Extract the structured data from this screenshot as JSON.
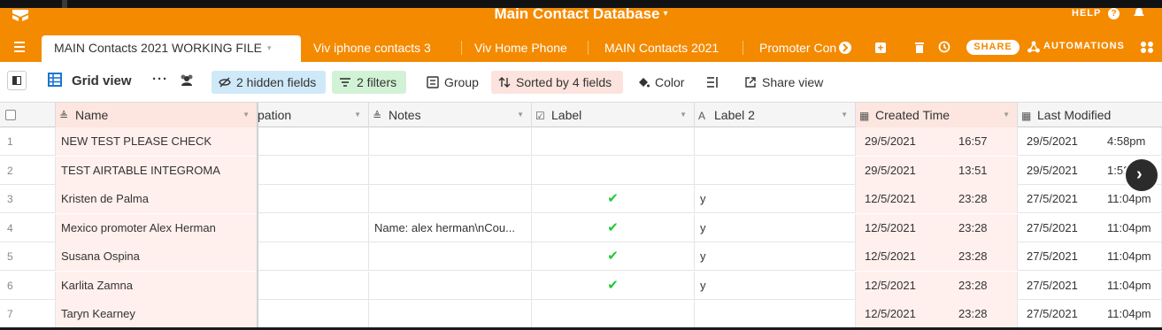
{
  "base": {
    "title": "Main Contact Database",
    "help_label": "HELP"
  },
  "tabs": [
    {
      "label": "MAIN Contacts 2021 WORKING FILE",
      "active": true
    },
    {
      "label": "Viv iphone contacts 3"
    },
    {
      "label": "Viv Home Phone"
    },
    {
      "label": "MAIN Contacts 2021"
    },
    {
      "label": "Promoter Con"
    }
  ],
  "header_actions": {
    "share_label": "SHARE",
    "automations_label": "AUTOMATIONS"
  },
  "toolbar": {
    "view_name": "Grid view",
    "more": "···",
    "hidden_fields": "2 hidden fields",
    "filters": "2 filters",
    "group": "Group",
    "sorted": "Sorted by 4 fields",
    "color": "Color",
    "share_view": "Share view"
  },
  "columns": {
    "name": "Name",
    "occupation": "pation",
    "notes": "Notes",
    "label": "Label",
    "label2": "Label 2",
    "created": "Created Time",
    "modified": "Last Modified"
  },
  "rows": [
    {
      "num": "1",
      "name": "NEW TEST PLEASE CHECK",
      "notes": "",
      "label": "",
      "label2": "",
      "created_date": "29/5/2021",
      "created_time": "16:57",
      "mod_date": "29/5/2021",
      "mod_time": "4:58pm"
    },
    {
      "num": "2",
      "name": "TEST AIRTABLE INTEGROMA",
      "notes": "",
      "label": "",
      "label2": "",
      "created_date": "29/5/2021",
      "created_time": "13:51",
      "mod_date": "29/5/2021",
      "mod_time": "1:52pm"
    },
    {
      "num": "3",
      "name": "Kristen de Palma",
      "notes": "",
      "label": "✔",
      "label2": "y",
      "created_date": "12/5/2021",
      "created_time": "23:28",
      "mod_date": "27/5/2021",
      "mod_time": "11:04pm"
    },
    {
      "num": "4",
      "name": "Mexico promoter Alex Herman",
      "notes": "Name: alex herman\\nCou...",
      "label": "✔",
      "label2": "y",
      "created_date": "12/5/2021",
      "created_time": "23:28",
      "mod_date": "27/5/2021",
      "mod_time": "11:04pm"
    },
    {
      "num": "5",
      "name": "Susana Ospina",
      "notes": "",
      "label": "✔",
      "label2": "y",
      "created_date": "12/5/2021",
      "created_time": "23:28",
      "mod_date": "27/5/2021",
      "mod_time": "11:04pm"
    },
    {
      "num": "6",
      "name": "Karlita Zamna",
      "notes": "",
      "label": "✔",
      "label2": "y",
      "created_date": "12/5/2021",
      "created_time": "23:28",
      "mod_date": "27/5/2021",
      "mod_time": "11:04pm"
    },
    {
      "num": "7",
      "name": "Taryn Kearney",
      "notes": "",
      "label": "",
      "label2": "",
      "created_date": "12/5/2021",
      "created_time": "23:28",
      "mod_date": "27/5/2021",
      "mod_time": "11:04pm"
    }
  ],
  "colors": {
    "accent": "#f48a00",
    "check": "#20c933",
    "sorted_bg": "#fde3dd",
    "filter_bg": "#d2f2d6",
    "hidden_bg": "#cfe9f9"
  },
  "icons": [
    "logo-icon",
    "help-icon",
    "bell-icon",
    "menu-icon",
    "tab-scroll-icon",
    "add-tab-icon",
    "trash-icon",
    "history-icon",
    "automations-icon",
    "apps-icon",
    "sidebar-toggle-icon",
    "grid-icon",
    "collaborators-icon",
    "eye-slash-icon",
    "filter-icon",
    "group-icon",
    "sort-icon",
    "color-bucket-icon",
    "row-height-icon",
    "share-icon",
    "text-field-icon",
    "checkbox-icon",
    "datetime-icon",
    "next-arrow-icon"
  ]
}
